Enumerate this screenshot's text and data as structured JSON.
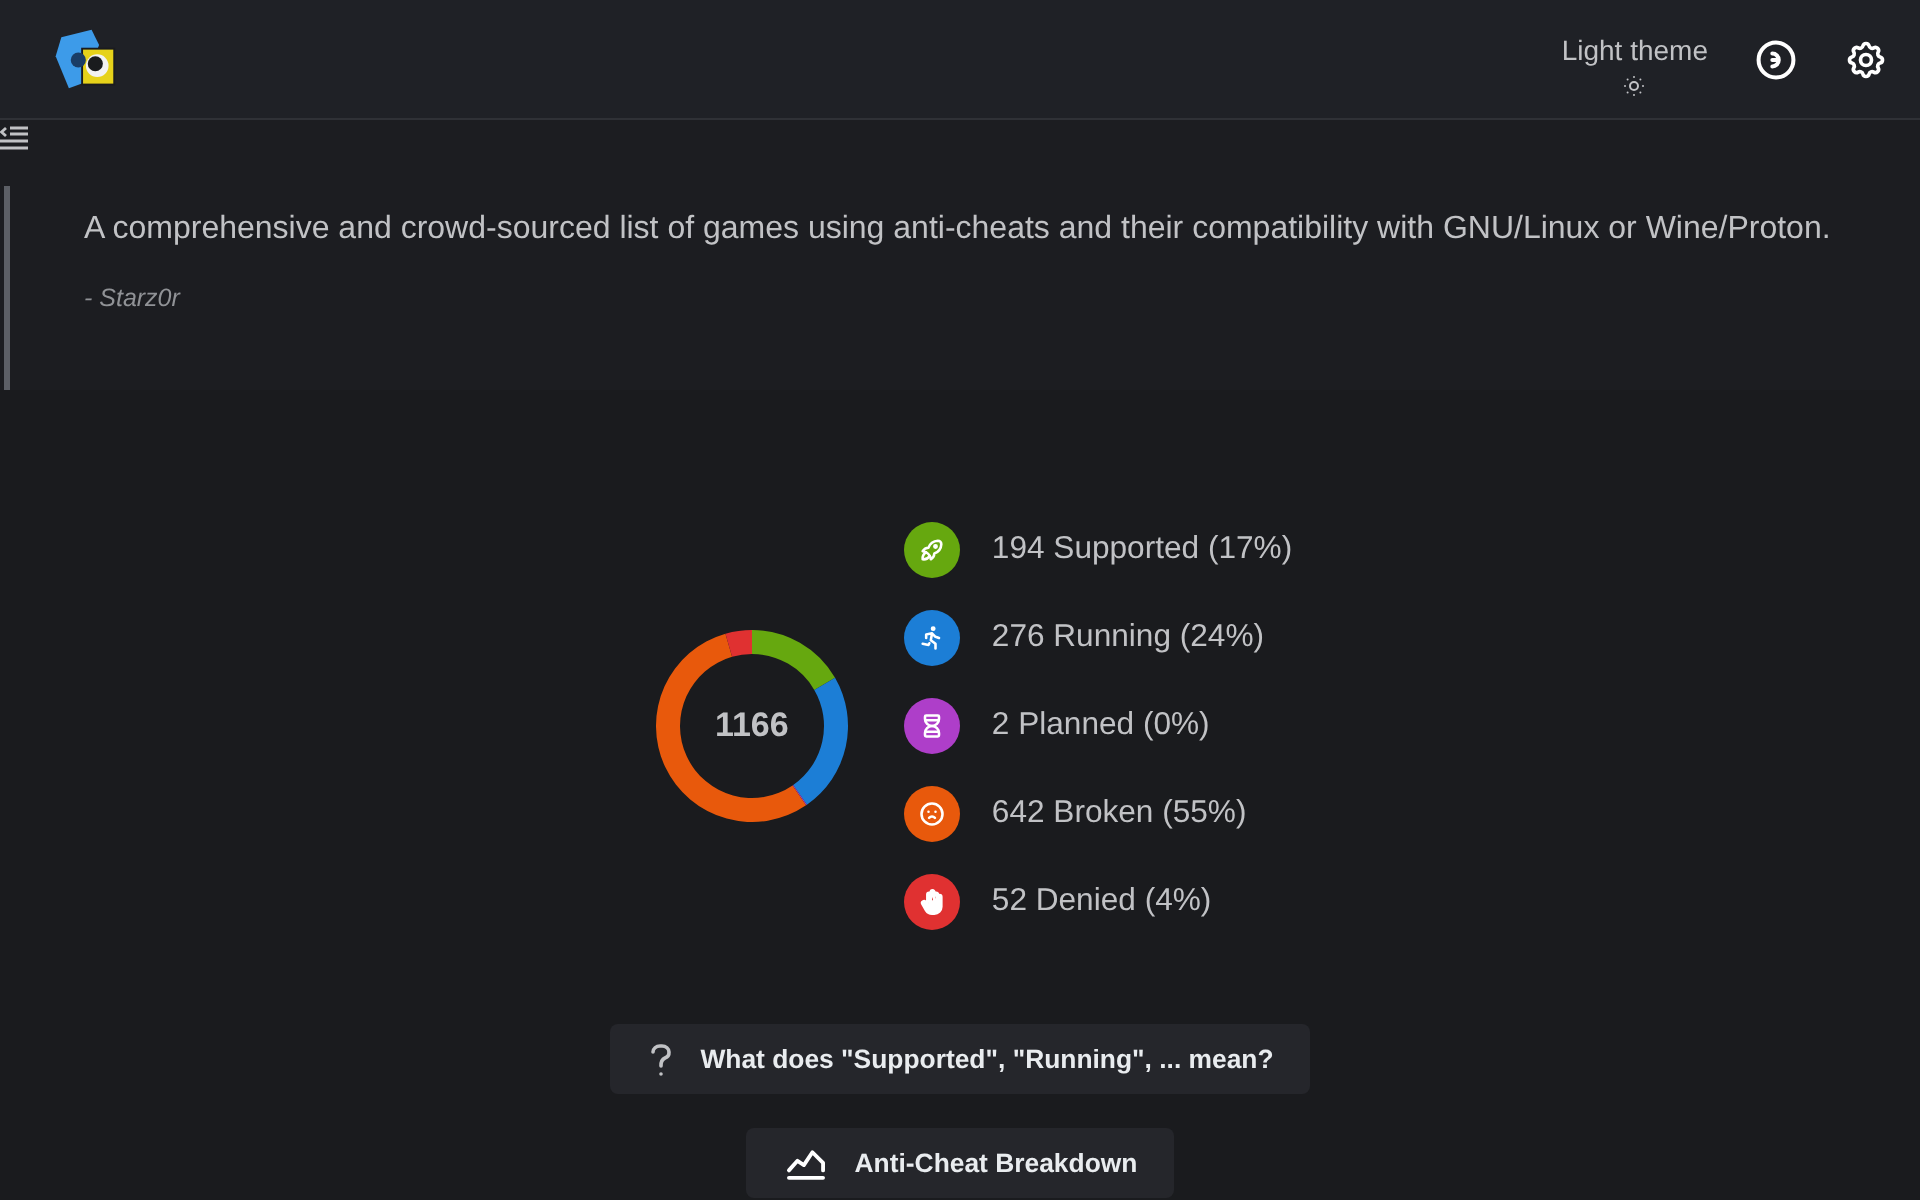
{
  "header": {
    "theme_toggle": {
      "label": "Light theme"
    }
  },
  "quote": {
    "text": "A comprehensive and crowd-sourced list of games using anti-cheats and their compatibility with GNU/Linux or Wine/Proton.",
    "author": "- Starz0r"
  },
  "summary": {
    "total": "1166",
    "chart_data": {
      "type": "donut",
      "categories": [
        "194 Supported (17%)",
        "276 Running (24%)",
        "2 Planned (0%)",
        "642 Broken (55%)",
        "52 Denied (4%)"
      ],
      "values": [
        194,
        276,
        2,
        642,
        52
      ],
      "legend": "right"
    },
    "legend": [
      {
        "kind": "supported",
        "color": "#66a80f"
      },
      {
        "kind": "running",
        "color": "#1c7ed6"
      },
      {
        "kind": "planned",
        "color": "#ae3ec9"
      },
      {
        "kind": "broken",
        "color": "#e8590c"
      },
      {
        "kind": "denied",
        "color": "#e03131"
      }
    ]
  },
  "buttons": [
    {
      "kind": "help",
      "label": "What does \"Supported\", \"Running\", ... mean?"
    },
    {
      "kind": "chart",
      "label": "Anti-Cheat Breakdown"
    }
  ]
}
